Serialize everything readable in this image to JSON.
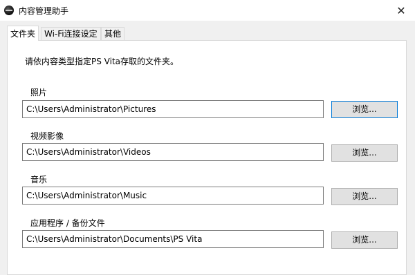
{
  "window": {
    "title": "内容管理助手",
    "close_glyph": "✕"
  },
  "tabs": [
    {
      "label": "文件夹",
      "active": true
    },
    {
      "label": "Wi-Fi连接设定",
      "active": false
    },
    {
      "label": "其他",
      "active": false
    }
  ],
  "description": "请依内容类型指定PS Vita存取的文件夹。",
  "folders": [
    {
      "label": "照片",
      "path": "C:\\Users\\Administrator\\Pictures",
      "button": "浏览..."
    },
    {
      "label": "视频影像",
      "path": "C:\\Users\\Administrator\\Videos",
      "button": "浏览..."
    },
    {
      "label": "音乐",
      "path": "C:\\Users\\Administrator\\Music",
      "button": "浏览..."
    },
    {
      "label": "应用程序 / 备份文件",
      "path": "C:\\Users\\Administrator\\Documents\\PS Vita",
      "button": "浏览..."
    }
  ]
}
